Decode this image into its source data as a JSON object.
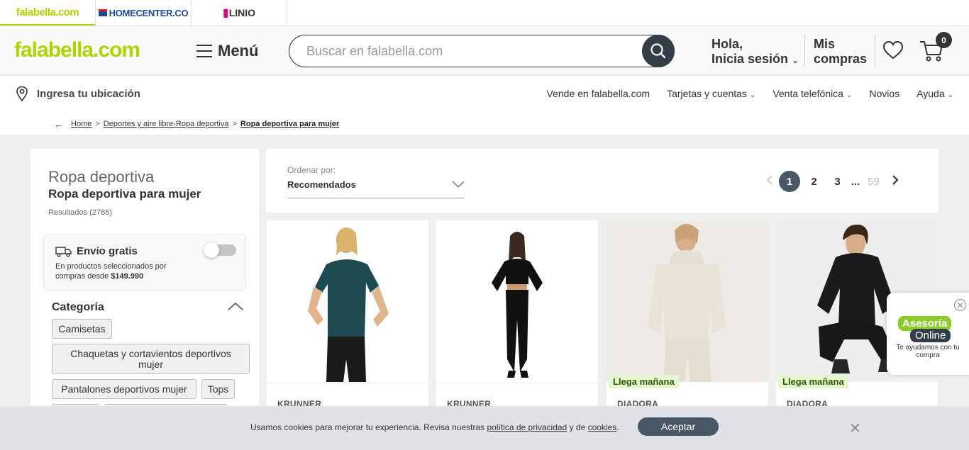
{
  "brand_tabs": [
    {
      "label": "falabella.com"
    },
    {
      "label": "HOMECENTER.CO"
    },
    {
      "label": "LINIO"
    }
  ],
  "header": {
    "logo": "falabella.com",
    "menu_label": "Menú",
    "search_placeholder": "Buscar en falabella.com",
    "login_line1": "Hola,",
    "login_line2": "Inicia sesión",
    "orders_line1": "Mis",
    "orders_line2": "compras",
    "cart_count": "0"
  },
  "subnav": {
    "location": "Ingresa tu ubicación",
    "links": [
      "Vende en falabella.com",
      "Tarjetas y cuentas",
      "Venta telefónica",
      "Novios",
      "Ayuda"
    ]
  },
  "breadcrumb": [
    "Home",
    "Deportes y aire libre-Ropa deportiva",
    "Ropa deportiva para mujer"
  ],
  "sidebar": {
    "parent_category": "Ropa deportiva",
    "current_category": "Ropa deportiva para mujer",
    "results": "Resultados (2786)",
    "free_shipping_title": "Envío gratis",
    "free_shipping_desc_1": "En productos seleccionados por",
    "free_shipping_desc_2": "compras desde",
    "free_shipping_amount": "$149.990",
    "free_shipping_enabled": false,
    "category_title": "Categoría",
    "category_pills": [
      "Camisetas",
      "Chaquetas y cortavientos deportivos mujer",
      "Pantalones deportivos mujer",
      "Tops"
    ]
  },
  "sort": {
    "label": "Ordenar por:",
    "value": "Recomendados"
  },
  "pagination": {
    "pages": [
      "1",
      "2",
      "3"
    ],
    "ellipsis": "...",
    "last": "59",
    "current": "1"
  },
  "products": [
    {
      "brand": "KRUNNER",
      "badge": ""
    },
    {
      "brand": "KRUNNER",
      "badge": ""
    },
    {
      "brand": "DIADORA",
      "badge": "Llega mañana"
    },
    {
      "brand": "DIADORA",
      "badge": "Llega mañana"
    }
  ],
  "chat": {
    "line1": "Asesoría",
    "line2": "Online",
    "sub": "Te ayudamos con tu compra"
  },
  "cookies": {
    "text_1": "Usamos cookies para mejorar tu experiencia. Revisa nuestras",
    "link_privacy": "política de privacidad",
    "text_2": "y de",
    "link_cookies": "cookies",
    "text_3": ".",
    "accept": "Aceptar"
  },
  "colors": {
    "brand_green": "#aad500",
    "dark_button": "#343e49",
    "badge_bg": "#e5f5d0"
  }
}
